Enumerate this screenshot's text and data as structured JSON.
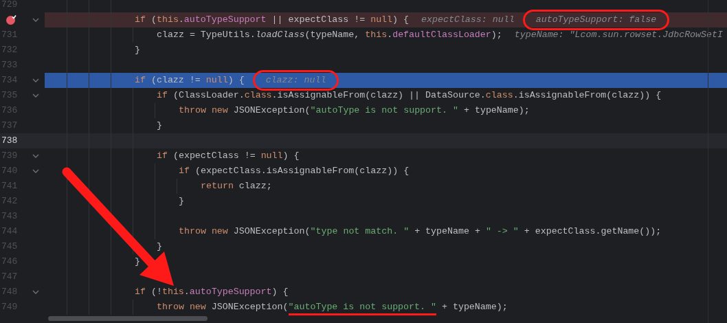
{
  "editor": {
    "lines": [
      {
        "number": "729",
        "fold": false
      },
      {
        "kind": "breakpoint",
        "fold": true,
        "tokens": [
          {
            "kind": "keyword",
            "text": "if"
          },
          {
            "kind": "plain",
            "text": " ("
          },
          {
            "kind": "keyword",
            "text": "this"
          },
          {
            "kind": "plain",
            "text": "."
          },
          {
            "kind": "field",
            "text": "autoTypeSupport"
          },
          {
            "kind": "plain",
            "text": " || expectClass != "
          },
          {
            "kind": "keyword",
            "text": "null"
          },
          {
            "kind": "plain",
            "text": ") {"
          }
        ],
        "hints": [
          {
            "text": "expectClass: null",
            "circled": false
          },
          {
            "text": "autoTypeSupport: false",
            "circled": true
          }
        ],
        "children": [
          {
            "number": "731",
            "fold": false,
            "tokens": [
              {
                "kind": "plain",
                "text": "clazz = TypeUtils."
              },
              {
                "kind": "method",
                "text": "loadClass"
              },
              {
                "kind": "plain",
                "text": "(typeName, "
              },
              {
                "kind": "keyword",
                "text": "this"
              },
              {
                "kind": "plain",
                "text": "."
              },
              {
                "kind": "field",
                "text": "defaultClassLoader"
              },
              {
                "kind": "plain",
                "text": ");"
              }
            ],
            "hints": [
              {
                "text": "typeName: \"Lcom.sun.rowset.JdbcRowSetI",
                "circled": false
              }
            ]
          }
        ]
      },
      {
        "number": "732",
        "fold": false,
        "tokens": [
          {
            "kind": "plain",
            "text": "}"
          }
        ]
      },
      {
        "number": "733",
        "fold": false
      },
      {
        "number": "734",
        "kind": "current",
        "fold": true,
        "tokens": [
          {
            "kind": "keyword",
            "text": "if"
          },
          {
            "kind": "plain",
            "text": " (clazz != "
          },
          {
            "kind": "keyword",
            "text": "null"
          },
          {
            "kind": "plain",
            "text": ") {"
          }
        ],
        "hints": [
          {
            "text": "clazz: null",
            "circled": true
          }
        ],
        "children": [
          {
            "number": "735",
            "fold": true,
            "tokens": [
              {
                "kind": "keyword",
                "text": "if"
              },
              {
                "kind": "plain",
                "text": " (ClassLoader."
              },
              {
                "kind": "keyword",
                "text": "class"
              },
              {
                "kind": "plain",
                "text": ".isAssignableFrom(clazz) || DataSource."
              },
              {
                "kind": "keyword",
                "text": "class"
              },
              {
                "kind": "plain",
                "text": ".isAssignableFrom(clazz)) {"
              }
            ],
            "children": [
              {
                "number": "736",
                "fold": false,
                "tokens": [
                  {
                    "kind": "keyword",
                    "text": "throw new"
                  },
                  {
                    "kind": "plain",
                    "text": " JSONException("
                  },
                  {
                    "kind": "string",
                    "text": "\"autoType is not support. \""
                  },
                  {
                    "kind": "plain",
                    "text": " + typeName);"
                  }
                ]
              }
            ]
          },
          {
            "number": "737",
            "fold": false,
            "tokens": [
              {
                "kind": "plain",
                "text": "}"
              }
            ]
          },
          {
            "number": "738",
            "kind": "caret",
            "fold": false
          },
          {
            "number": "739",
            "fold": true,
            "tokens": [
              {
                "kind": "keyword",
                "text": "if"
              },
              {
                "kind": "plain",
                "text": " (expectClass != "
              },
              {
                "kind": "keyword",
                "text": "null"
              },
              {
                "kind": "plain",
                "text": ") {"
              }
            ],
            "children": [
              {
                "number": "740",
                "fold": true,
                "tokens": [
                  {
                    "kind": "keyword",
                    "text": "if"
                  },
                  {
                    "kind": "plain",
                    "text": " (expectClass.isAssignableFrom(clazz)) {"
                  }
                ],
                "children": [
                  {
                    "number": "741",
                    "fold": false,
                    "tokens": [
                      {
                        "kind": "keyword",
                        "text": "return"
                      },
                      {
                        "kind": "plain",
                        "text": " clazz;"
                      }
                    ]
                  }
                ]
              },
              {
                "number": "742",
                "fold": false,
                "tokens": [
                  {
                    "kind": "plain",
                    "text": "}"
                  }
                ]
              },
              {
                "number": "743",
                "fold": false
              },
              {
                "number": "744",
                "fold": false,
                "tokens": [
                  {
                    "kind": "keyword",
                    "text": "throw new"
                  },
                  {
                    "kind": "plain",
                    "text": " JSONException("
                  },
                  {
                    "kind": "string",
                    "text": "\"type not match. \""
                  },
                  {
                    "kind": "plain",
                    "text": " + typeName + "
                  },
                  {
                    "kind": "string",
                    "text": "\" -> \""
                  },
                  {
                    "kind": "plain",
                    "text": " + expectClass.getName());"
                  }
                ]
              }
            ]
          },
          {
            "number": "745",
            "fold": false,
            "tokens": [
              {
                "kind": "plain",
                "text": "}"
              }
            ]
          }
        ]
      },
      {
        "number": "746",
        "fold": false,
        "tokens": [
          {
            "kind": "plain",
            "text": "}"
          }
        ]
      },
      {
        "number": "747",
        "fold": false
      },
      {
        "number": "748",
        "fold": true,
        "tokens": [
          {
            "kind": "keyword",
            "text": "if"
          },
          {
            "kind": "plain",
            "text": " (!"
          },
          {
            "kind": "keyword",
            "text": "this"
          },
          {
            "kind": "plain",
            "text": "."
          },
          {
            "kind": "field",
            "text": "autoTypeSupport"
          },
          {
            "kind": "plain",
            "text": ") {"
          }
        ],
        "children": [
          {
            "number": "749",
            "fold": false,
            "tokens": [
              {
                "kind": "keyword",
                "text": "throw new"
              },
              {
                "kind": "plain",
                "text": " JSONException("
              },
              {
                "kind": "string",
                "text": "\"autoType is not support. \"",
                "underlined": true
              },
              {
                "kind": "plain",
                "text": " + typeName);"
              }
            ]
          }
        ]
      }
    ]
  }
}
